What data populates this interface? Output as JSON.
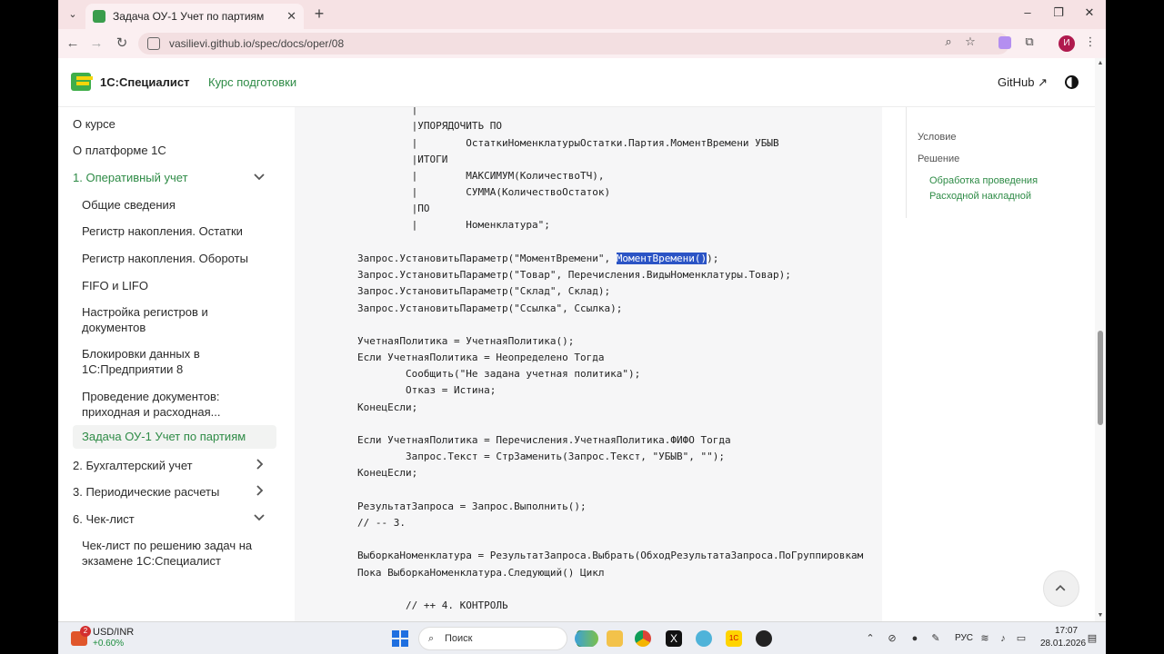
{
  "browser": {
    "tab_title": "Задача ОУ-1 Учет по партиям",
    "url": "vasilievi.github.io/spec/docs/oper/08",
    "profile_initial": "И"
  },
  "header": {
    "brand": "1С:Специалист",
    "course_link": "Курс подготовки",
    "github": "GitHub"
  },
  "sidebar": {
    "items": [
      {
        "label": "О курсе"
      },
      {
        "label": "О платформе 1С"
      },
      {
        "label": "1. Оперативный учет"
      },
      {
        "label": "Общие сведения"
      },
      {
        "label": "Регистр накопления. Остатки"
      },
      {
        "label": "Регистр накопления. Обороты"
      },
      {
        "label": "FIFO и LIFO"
      },
      {
        "label": "Настройка регистров и документов"
      },
      {
        "label": "Блокировки данных в 1С:Предприятии 8"
      },
      {
        "label": "Проведение документов: приходная и расходная..."
      },
      {
        "label": "Задача ОУ-1 Учет по партиям"
      },
      {
        "label": "2. Бухгалтерский учет"
      },
      {
        "label": "3. Периодические расчеты"
      },
      {
        "label": "6. Чек-лист"
      },
      {
        "label": "Чек-лист по решению задач на экзамене 1С:Специалист"
      }
    ]
  },
  "code": {
    "lines": [
      "         |",
      "         |УПОРЯДОЧИТЬ ПО",
      "         |        ОстаткиНоменклатурыОстатки.Партия.МоментВремени УБЫВ",
      "         |ИТОГИ",
      "         |        МАКСИМУМ(КоличествоТЧ),",
      "         |        СУММА(КоличествоОстаток)",
      "         |ПО",
      "         |        Номенклатура\";",
      "",
      "Запрос.УстановитьПараметр(\"МоментВремени\", ",
      "Запрос.УстановитьПараметр(\"Товар\", Перечисления.ВидыНоменклатуры.Товар);",
      "Запрос.УстановитьПараметр(\"Склад\", Склад);",
      "Запрос.УстановитьПараметр(\"Ссылка\", Ссылка);",
      "",
      "УчетнаяПолитика = УчетнаяПолитика();",
      "Если УчетнаяПолитика = Неопределено Тогда",
      "        Сообщить(\"Не задана учетная политика\");",
      "        Отказ = Истина;",
      "КонецЕсли;",
      "",
      "Если УчетнаяПолитика = Перечисления.УчетнаяПолитика.ФИФО Тогда",
      "        Запрос.Текст = СтрЗаменить(Запрос.Текст, \"УБЫВ\", \"\");",
      "КонецЕсли;",
      "",
      "РезультатЗапроса = Запрос.Выполнить();",
      "// -- 3.",
      "",
      "ВыборкаНоменклатура = РезультатЗапроса.Выбрать(ОбходРезультатаЗапроса.ПоГруппировкам",
      "Пока ВыборкаНоменклатура.Следующий() Цикл",
      "",
      "",
      "        // ++ 4. КОНТРОЛЬ"
    ],
    "highlighted": "МоментВремени()",
    "after_highlight": ");"
  },
  "toc": {
    "items": [
      {
        "label": "Условие"
      },
      {
        "label": "Решение"
      },
      {
        "label": "Обработка проведения"
      },
      {
        "label": "Расходной накладной"
      }
    ]
  },
  "taskbar": {
    "ticker": "USD/INR",
    "ticker_change": "+0.60%",
    "notif_count": "2",
    "search": "Поиск",
    "lang": "РУС",
    "time": "17:07",
    "date": "28.01.2026"
  },
  "colors": {
    "accent_green": "#2e8b46",
    "tab_strip": "#f6e2e4",
    "selection": "#2b54c5"
  }
}
